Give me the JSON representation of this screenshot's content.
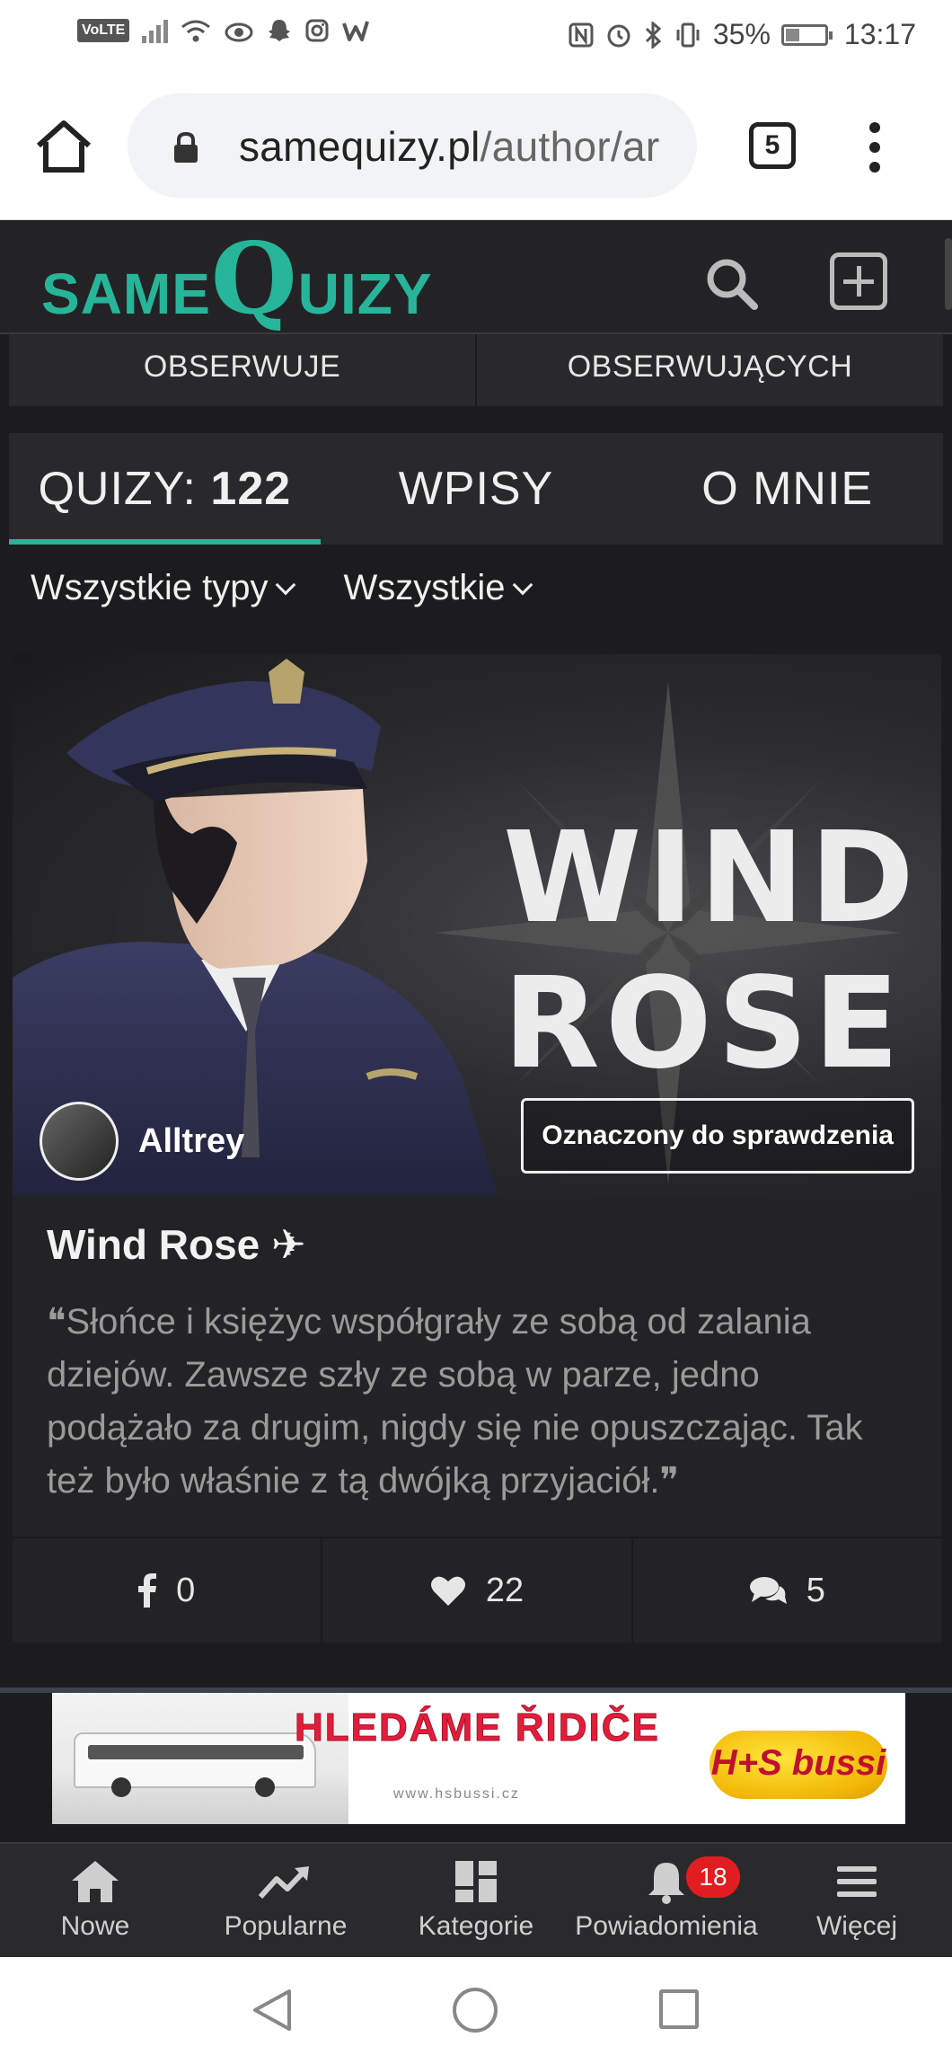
{
  "status_bar": {
    "volte": "VoLTE",
    "battery": "35%",
    "battery_level": 0.35,
    "time": "13:17",
    "icons": [
      "volte-icon",
      "signal-icon",
      "wifi-icon",
      "eye-icon",
      "snapchat-icon",
      "instagram-icon",
      "wattpad-icon",
      "nfc-icon",
      "alarm-icon",
      "bluetooth-icon",
      "vibrate-icon",
      "battery-icon"
    ]
  },
  "browser": {
    "url_domain": "samequizy.pl",
    "url_path": "/author/ar",
    "tab_count": "5",
    "icons": [
      "home-icon",
      "lock-icon",
      "tabs-icon",
      "more-vert-icon"
    ]
  },
  "site": {
    "logo_prefix": "SAME",
    "logo_q": "Q",
    "logo_suffix": "UIZY",
    "accent_color": "#27b59a",
    "icons": [
      "search-icon",
      "add-square-icon"
    ]
  },
  "profile": {
    "following_label": "OBSERWUJE",
    "followers_label": "OBSERWUJĄCYCH",
    "tabs": {
      "quizzes_label": "QUIZY: ",
      "quizzes_count": "122",
      "posts_label": "WPISY",
      "about_label": "O MNIE"
    },
    "filters": {
      "type_label": "Wszystkie typy",
      "scope_label": "Wszystkie"
    }
  },
  "quiz_card": {
    "image_text_line1": "WIND",
    "image_text_line2": "ROSE",
    "author_name": "Alltrey",
    "badge": "Oznaczony do sprawdzenia",
    "title": "Wind Rose ✈",
    "quote_open": "❝",
    "description": "Słońce i księżyc współgrały ze sobą od zalania dziejów. Zawsze szły ze sobą w parze, jedno podążało za drugim, nigdy się nie opuszczając. Tak też było właśnie z tą dwójką przyjaciół.",
    "quote_close": "❞",
    "shares": "0",
    "likes": "22",
    "comments": "5"
  },
  "ad": {
    "headline": "HLEDÁME ŘIDIČE",
    "url_text": "www.hsbussi.cz",
    "logo_text": "H+S bussi",
    "headline_color": "#e01e3c"
  },
  "bottom_nav": {
    "items": [
      {
        "label": "Nowe",
        "icon": "home-icon"
      },
      {
        "label": "Popularne",
        "icon": "trending-icon"
      },
      {
        "label": "Kategorie",
        "icon": "grid-icon"
      },
      {
        "label": "Powiadomienia",
        "icon": "bell-icon"
      },
      {
        "label": "Więcej",
        "icon": "hamburger-icon"
      }
    ],
    "notifications_badge": "18"
  }
}
